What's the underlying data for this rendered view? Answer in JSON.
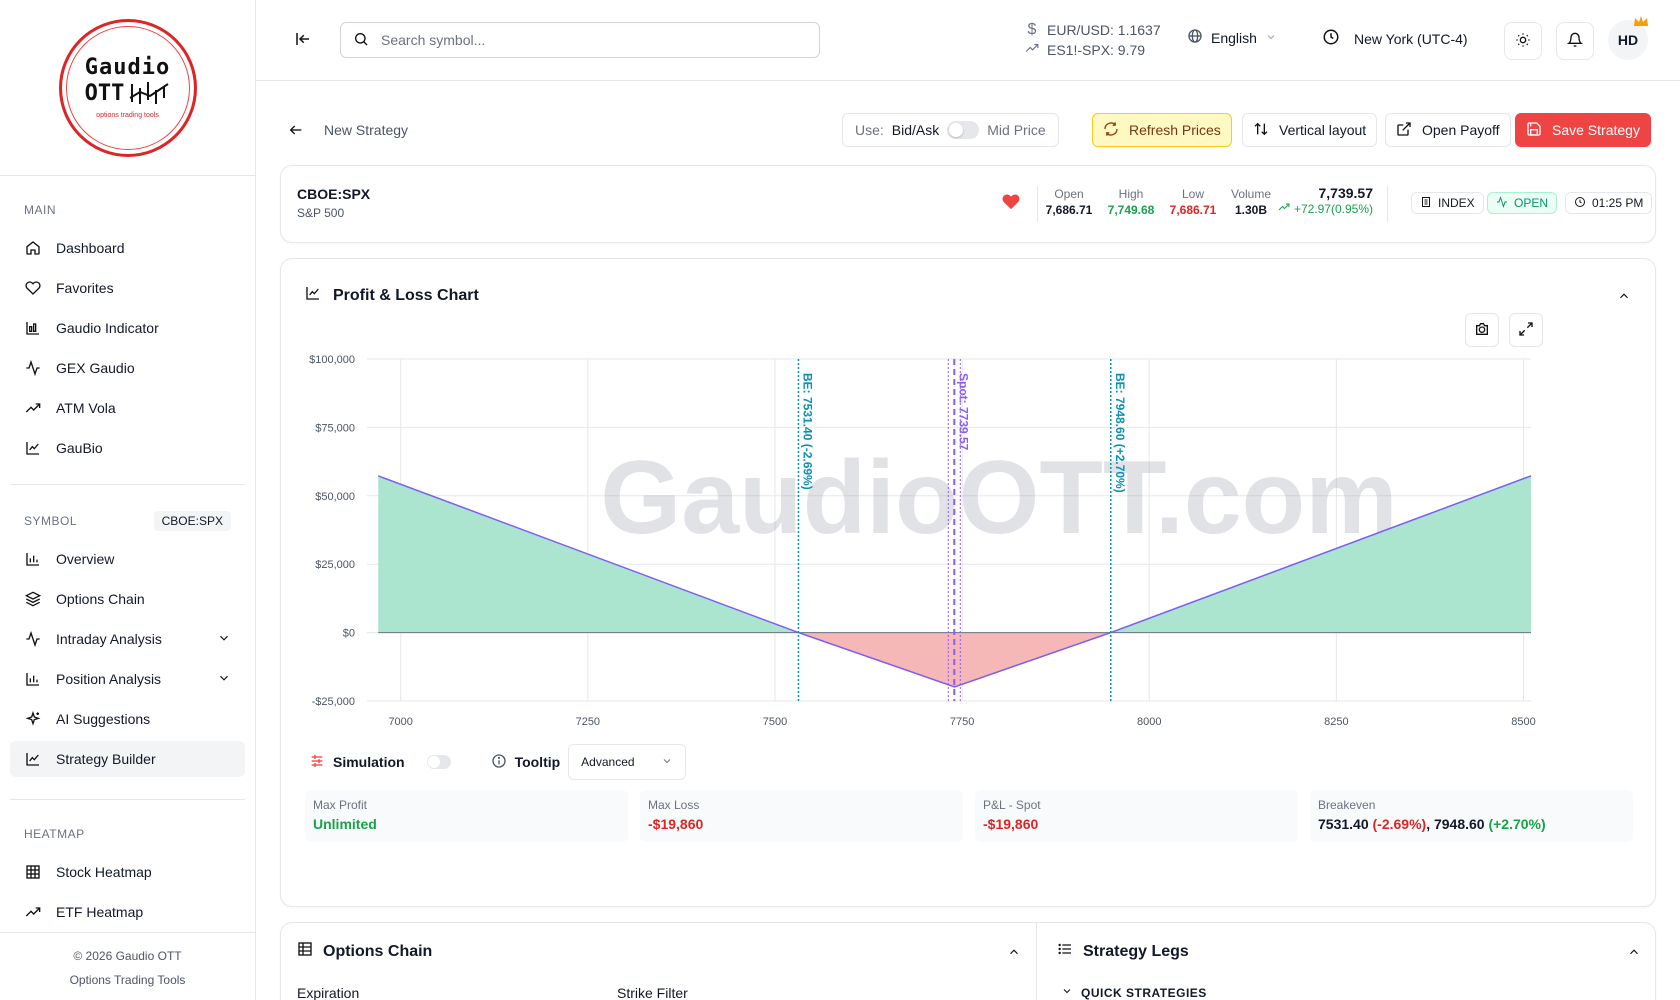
{
  "logo": {
    "line1": "Gaudio",
    "line2": "OTT",
    "tagline": "options trading tools"
  },
  "sidebar": {
    "main_label": "MAIN",
    "main_items": [
      {
        "label": "Dashboard",
        "icon": "home-icon"
      },
      {
        "label": "Favorites",
        "icon": "heart-icon"
      },
      {
        "label": "Gaudio Indicator",
        "icon": "bar-chart-icon"
      },
      {
        "label": "GEX Gaudio",
        "icon": "activity-icon"
      },
      {
        "label": "ATM Vola",
        "icon": "trend-icon"
      },
      {
        "label": "GauBio",
        "icon": "chart-line-icon"
      }
    ],
    "symbol_label": "SYMBOL",
    "symbol_badge": "CBOE:SPX",
    "symbol_items": [
      {
        "label": "Overview",
        "icon": "bar-chart-icon"
      },
      {
        "label": "Options Chain",
        "icon": "layers-icon"
      },
      {
        "label": "Intraday Analysis",
        "icon": "activity-icon",
        "expandable": true
      },
      {
        "label": "Position Analysis",
        "icon": "bar-chart-icon",
        "expandable": true
      },
      {
        "label": "AI Suggestions",
        "icon": "sparkles-icon"
      },
      {
        "label": "Strategy Builder",
        "icon": "chart-line-icon",
        "active": true
      }
    ],
    "heatmap_label": "HEATMAP",
    "heatmap_items": [
      {
        "label": "Stock Heatmap",
        "icon": "grid-icon"
      },
      {
        "label": "ETF Heatmap",
        "icon": "trend-icon"
      }
    ],
    "footer_line1": "© 2026 Gaudio OTT",
    "footer_line2": "Options Trading Tools"
  },
  "header": {
    "search_placeholder": "Search symbol...",
    "quote1": "EUR/USD: 1.1637",
    "quote2": "ES1!-SPX: 9.79",
    "language": "English",
    "timezone": "New York (UTC-4)",
    "avatar": "HD"
  },
  "toolbar": {
    "breadcrumb": "New Strategy",
    "use_label": "Use:",
    "bid_ask": "Bid/Ask",
    "mid_price": "Mid Price",
    "refresh": "Refresh Prices",
    "vertical": "Vertical layout",
    "open_payoff": "Open Payoff",
    "save": "Save Strategy"
  },
  "quote": {
    "symbol": "CBOE:SPX",
    "name": "S&P 500",
    "open_label": "Open",
    "open": "7,686.71",
    "high_label": "High",
    "high": "7,749.68",
    "low_label": "Low",
    "low": "7,686.71",
    "volume_label": "Volume",
    "volume": "1.30B",
    "price": "7,739.57",
    "change": "+72.97(0.95%)",
    "type": "INDEX",
    "status": "OPEN",
    "time": "01:25 PM"
  },
  "pl": {
    "title": "Profit & Loss Chart",
    "watermark": "GaudioOTT.com",
    "simulation": "Simulation",
    "tooltip": "Tooltip",
    "tooltip_mode": "Advanced",
    "metrics": [
      {
        "label": "Max Profit",
        "value": "Unlimited",
        "color": "green"
      },
      {
        "label": "Max Loss",
        "value": "-$19,860",
        "color": "red"
      },
      {
        "label": "P&L - Spot",
        "value": "-$19,860",
        "color": "red"
      }
    ],
    "breakeven_label": "Breakeven",
    "breakeven_v1": "7531.40",
    "breakeven_p1": "(-2.69%)",
    "breakeven_v2": "7948.60",
    "breakeven_p2": "(+2.70%)"
  },
  "chart_data": {
    "type": "area",
    "x": [
      6970,
      7531.4,
      7740,
      7948.6,
      8510
    ],
    "y": [
      57290,
      0,
      -19860,
      0,
      57290
    ],
    "xlim": [
      6955,
      8510
    ],
    "ylim": [
      -25000,
      100000
    ],
    "x_ticks": [
      7000,
      7250,
      7500,
      7750,
      8000,
      8250,
      8500
    ],
    "y_ticks": [
      -25000,
      0,
      25000,
      50000,
      75000,
      100000
    ],
    "y_tick_labels": [
      "-$25,000",
      "$0",
      "$25,000",
      "$50,000",
      "$75,000",
      "$100,000"
    ],
    "annotations": [
      {
        "x": 7531.4,
        "label": "BE: 7531.40 (-2.69%)",
        "color": "#0891b2"
      },
      {
        "x": 7739.57,
        "label": "Spot: 7739.57",
        "color": "#8b5cf6"
      },
      {
        "x": 7948.6,
        "label": "BE: 7948.60 (+2.70%)",
        "color": "#0891b2"
      }
    ],
    "colors": {
      "profit": "#a7e3cc",
      "loss": "#f6b3b3",
      "line": "#7c5cf5"
    },
    "grid": true
  },
  "options_chain": {
    "title": "Options Chain",
    "expiration": "Expiration",
    "strike_filter": "Strike Filter"
  },
  "legs": {
    "title": "Strategy Legs",
    "quick": "QUICK STRATEGIES"
  }
}
